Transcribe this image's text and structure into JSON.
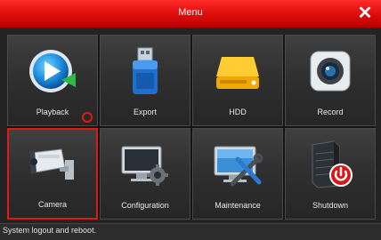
{
  "window": {
    "title": "Menu",
    "close_glyph": "✕"
  },
  "menu_items": [
    {
      "label": "Playback",
      "icon": "playback-icon"
    },
    {
      "label": "Export",
      "icon": "usb-drive-icon"
    },
    {
      "label": "HDD",
      "icon": "hard-drive-icon"
    },
    {
      "label": "Record",
      "icon": "record-icon"
    },
    {
      "label": "Camera",
      "icon": "camera-icon",
      "selected": true
    },
    {
      "label": "Configuration",
      "icon": "configuration-icon"
    },
    {
      "label": "Maintenance",
      "icon": "maintenance-icon"
    },
    {
      "label": "Shutdown",
      "icon": "shutdown-icon"
    }
  ],
  "status_bar": {
    "text": "System logout and reboot."
  },
  "colors": {
    "accent": "#e01818",
    "title_bar": "#e00d0d",
    "background": "#232323"
  }
}
